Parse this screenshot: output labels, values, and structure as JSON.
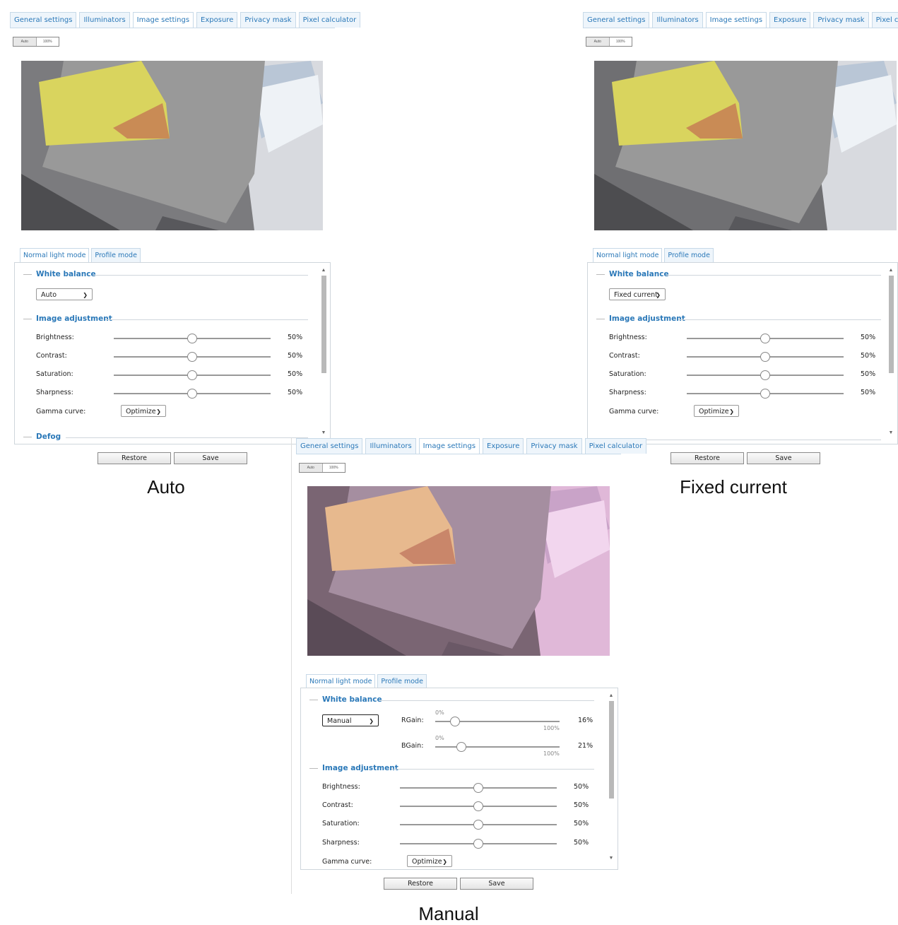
{
  "tabs": [
    "General settings",
    "Illuminators",
    "Image settings",
    "Exposure",
    "Privacy mask",
    "Pixel calculator"
  ],
  "active_tab": "Image settings",
  "view_toggle": [
    "Auto",
    "100%"
  ],
  "subtabs": [
    "Normal light mode",
    "Profile mode"
  ],
  "section_white_balance": "White balance",
  "section_image_adjustment": "Image adjustment",
  "section_defog": "Defog",
  "labels": {
    "brightness": "Brightness:",
    "contrast": "Contrast:",
    "saturation": "Saturation:",
    "sharpness": "Sharpness:",
    "gamma": "Gamma curve:",
    "rgain": "RGain:",
    "bgain": "BGain:"
  },
  "gamma_value": "Optimize",
  "buttons": {
    "restore": "Restore",
    "save": "Save"
  },
  "panels": [
    {
      "caption": "Auto",
      "white_balance": "Auto",
      "brightness": "50%",
      "contrast": "50%",
      "saturation": "50%",
      "sharpness": "50%",
      "brightness_value": 0.5,
      "contrast_value": 0.5,
      "saturation_value": 0.5,
      "sharpness_value": 0.5
    },
    {
      "caption": "Fixed current",
      "white_balance": "Fixed current",
      "brightness": "50%",
      "contrast": "50%",
      "saturation": "50%",
      "sharpness": "50%",
      "brightness_value": 0.5,
      "contrast_value": 0.5,
      "saturation_value": 0.5,
      "sharpness_value": 0.5
    },
    {
      "caption": "Manual",
      "white_balance": "Manual",
      "rgain": "16%",
      "bgain": "21%",
      "rgain_value": 0.16,
      "bgain_value": 0.21,
      "gain_min": "0%",
      "gain_max": "100%",
      "brightness": "50%",
      "contrast": "50%",
      "saturation": "50%",
      "sharpness": "50%",
      "brightness_value": 0.5,
      "contrast_value": 0.5,
      "saturation_value": 0.5,
      "sharpness_value": 0.5
    }
  ],
  "colors": {
    "accent": "#2a78b8",
    "tab_bg": "#eef5fb",
    "tab_border": "#c7d9e8"
  }
}
